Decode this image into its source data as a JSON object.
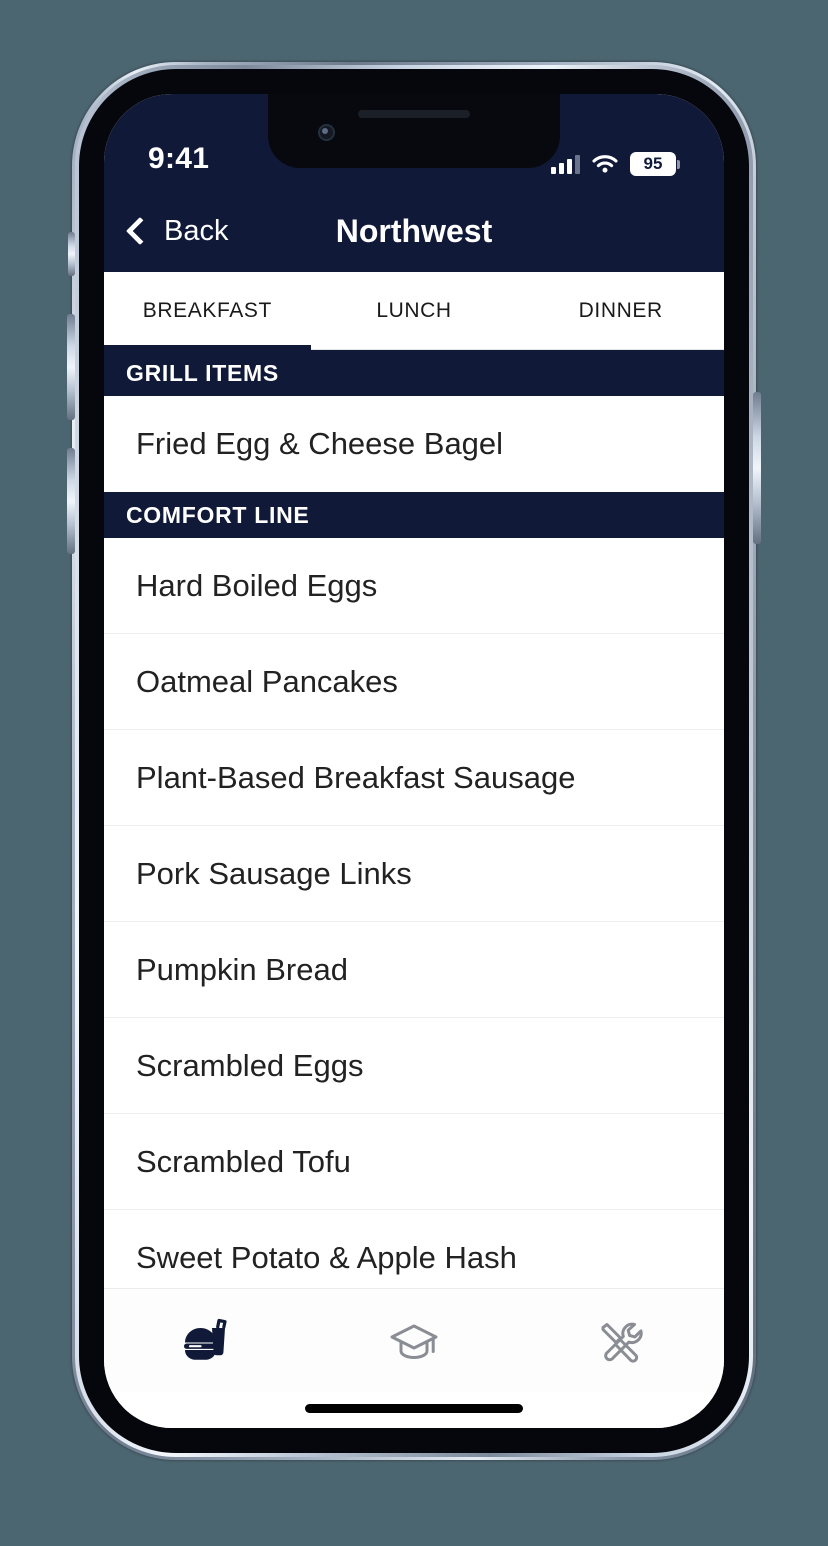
{
  "theme": {
    "page_background": "#4c6671",
    "brand_navy": "#101a38",
    "surface": "#ffffff",
    "divider": "#eeeeee",
    "muted_icon": "#8a8d94",
    "filler_gray": "#f0f0f0"
  },
  "status_bar": {
    "time": "9:41",
    "signal_icon": "cellular-signal-icon",
    "wifi_icon": "wifi-icon",
    "battery_level": "95",
    "battery_icon": "battery-icon"
  },
  "navbar": {
    "back_icon": "chevron-left-icon",
    "back_label": "Back",
    "title": "Northwest"
  },
  "meal_tabs": {
    "active_index": 0,
    "items": [
      {
        "label": "BREAKFAST"
      },
      {
        "label": "LUNCH"
      },
      {
        "label": "DINNER"
      }
    ]
  },
  "menu": {
    "sections": [
      {
        "title": "GRILL ITEMS",
        "items": [
          {
            "name": "Fried Egg & Cheese Bagel"
          }
        ]
      },
      {
        "title": "COMFORT LINE",
        "items": [
          {
            "name": "Hard Boiled Eggs"
          },
          {
            "name": "Oatmeal Pancakes"
          },
          {
            "name": "Plant-Based Breakfast Sausage"
          },
          {
            "name": "Pork Sausage Links"
          },
          {
            "name": "Pumpkin Bread"
          },
          {
            "name": "Scrambled Eggs"
          },
          {
            "name": "Scrambled Tofu"
          },
          {
            "name": "Sweet Potato & Apple Hash"
          }
        ]
      }
    ]
  },
  "tabbar": {
    "active_index": 0,
    "items": [
      {
        "icon": "food-burger-drink-icon",
        "active": true
      },
      {
        "icon": "graduation-cap-icon",
        "active": false
      },
      {
        "icon": "hammer-wrench-tools-icon",
        "active": false
      }
    ]
  }
}
